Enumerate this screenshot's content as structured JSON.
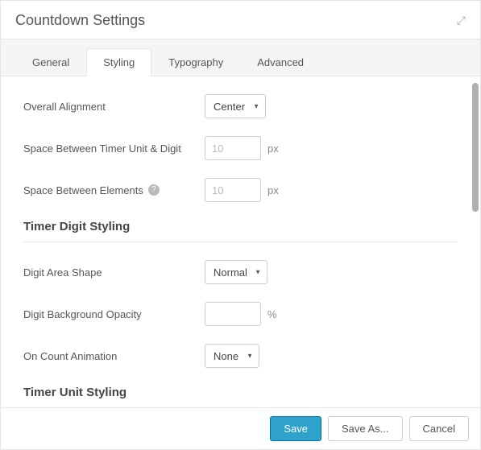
{
  "header": {
    "title": "Countdown Settings"
  },
  "tabs": [
    {
      "label": "General"
    },
    {
      "label": "Styling"
    },
    {
      "label": "Typography"
    },
    {
      "label": "Advanced"
    }
  ],
  "fields": {
    "overall_alignment": {
      "label": "Overall Alignment",
      "value": "Center"
    },
    "space_unit_digit": {
      "label": "Space Between Timer Unit & Digit",
      "placeholder": "10",
      "unit": "px"
    },
    "space_elements": {
      "label": "Space Between Elements",
      "placeholder": "10",
      "unit": "px"
    },
    "digit_area_shape": {
      "label": "Digit Area Shape",
      "value": "Normal"
    },
    "digit_bg_opacity": {
      "label": "Digit Background Opacity",
      "value": "",
      "unit": "%"
    },
    "count_animation": {
      "label": "On Count Animation",
      "value": "None"
    }
  },
  "sections": {
    "digit_styling": "Timer Digit Styling",
    "unit_styling": "Timer Unit Styling"
  },
  "footer": {
    "save": "Save",
    "save_as": "Save As...",
    "cancel": "Cancel"
  }
}
